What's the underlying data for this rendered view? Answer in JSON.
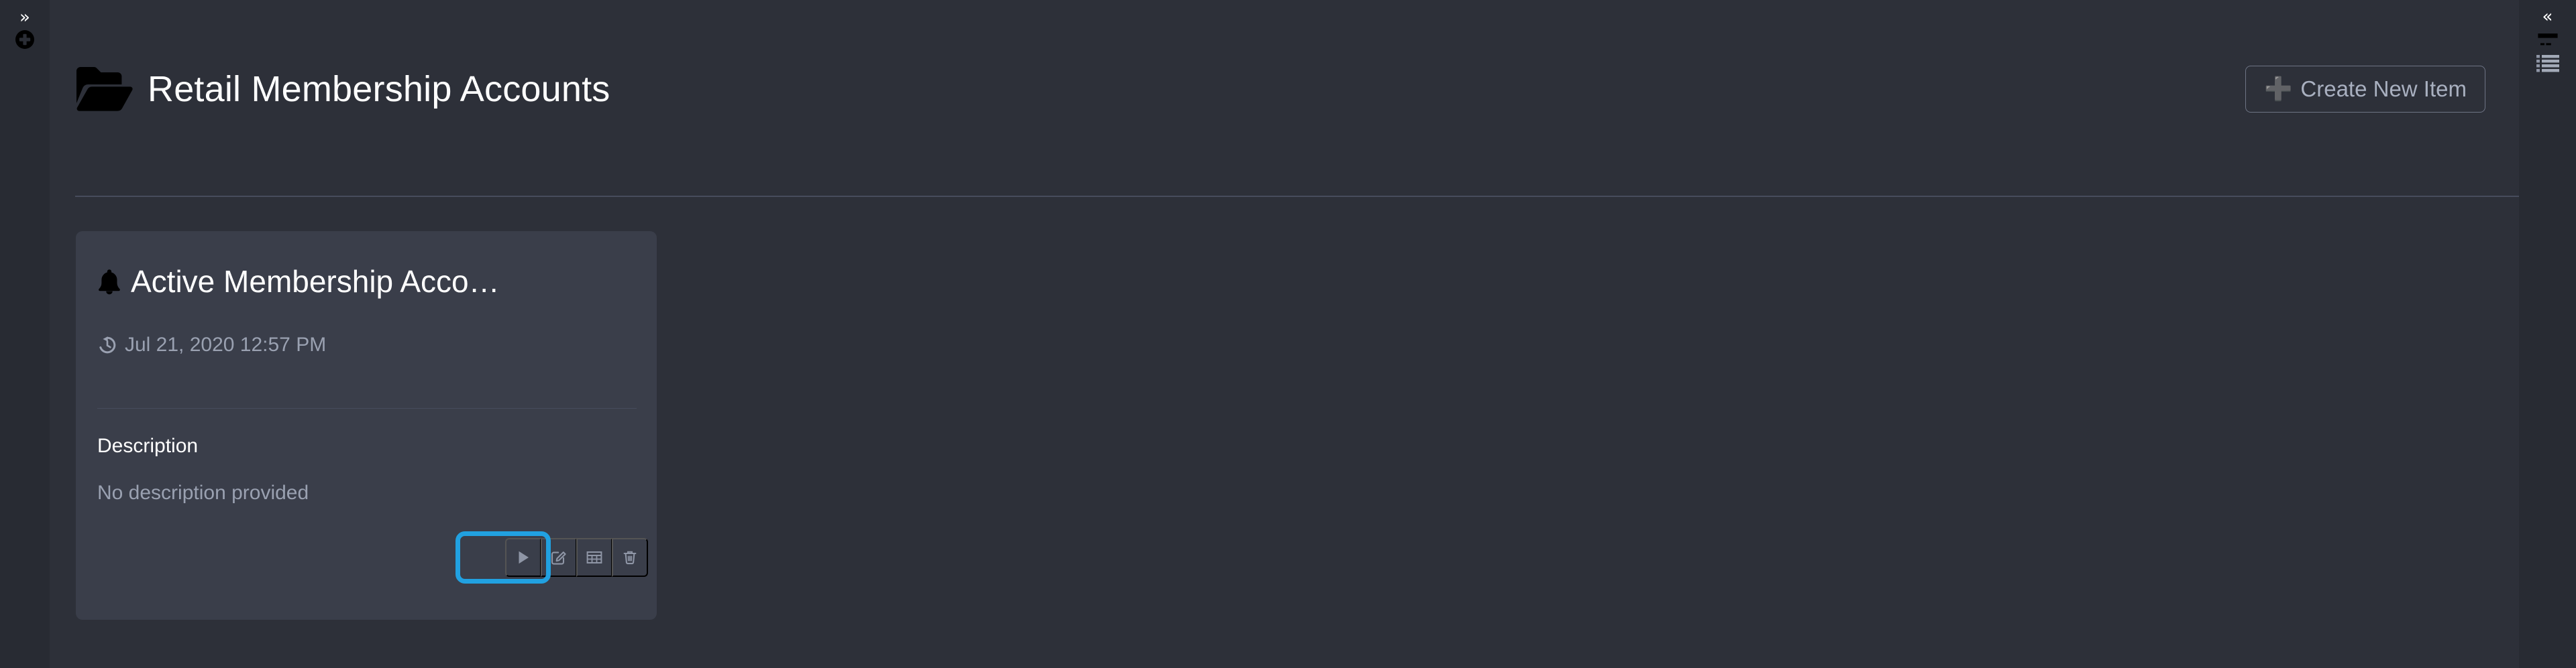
{
  "colors": {
    "background": "#2d3039",
    "rail_background": "#282b33",
    "card_background": "#3a3e4a",
    "accent_orange": "#f5a council",
    "accent_orange_text": "#f5a councilED",
    "muted_text": "#9aa1b1",
    "divider": "#474c5c",
    "highlight_blue": "#21a1e1"
  },
  "left_rail": {
    "collapse_icon": "chevron-double-right-icon",
    "collapse_glyph": "»",
    "add_icon": "plus-circle-icon"
  },
  "right_rail": {
    "collapse_icon": "chevron-double-left-icon",
    "collapse_glyph": "«",
    "items": [
      {
        "icon": "credit-card-icon",
        "active": true
      },
      {
        "icon": "list-icon",
        "active": false
      }
    ]
  },
  "header": {
    "icon": "folder-open-icon",
    "title": "Retail Membership Accounts",
    "create_button": {
      "icon": "plus-icon",
      "glyph": "➕",
      "label": "Create New Item"
    }
  },
  "cards": [
    {
      "icon": "bell-icon",
      "title": "Active Membership Acco…",
      "timestamp_icon": "history-icon",
      "timestamp": "Jul 21, 2020 12:57 PM",
      "description_label": "Description",
      "description_value": "No description provided",
      "actions": [
        {
          "name": "run-button",
          "icon": "play-icon",
          "highlighted": true
        },
        {
          "name": "edit-button",
          "icon": "pencil-square-icon",
          "highlighted": false
        },
        {
          "name": "table-button",
          "icon": "table-icon",
          "highlighted": false
        },
        {
          "name": "delete-button",
          "icon": "trash-icon",
          "highlighted": false
        }
      ]
    }
  ]
}
